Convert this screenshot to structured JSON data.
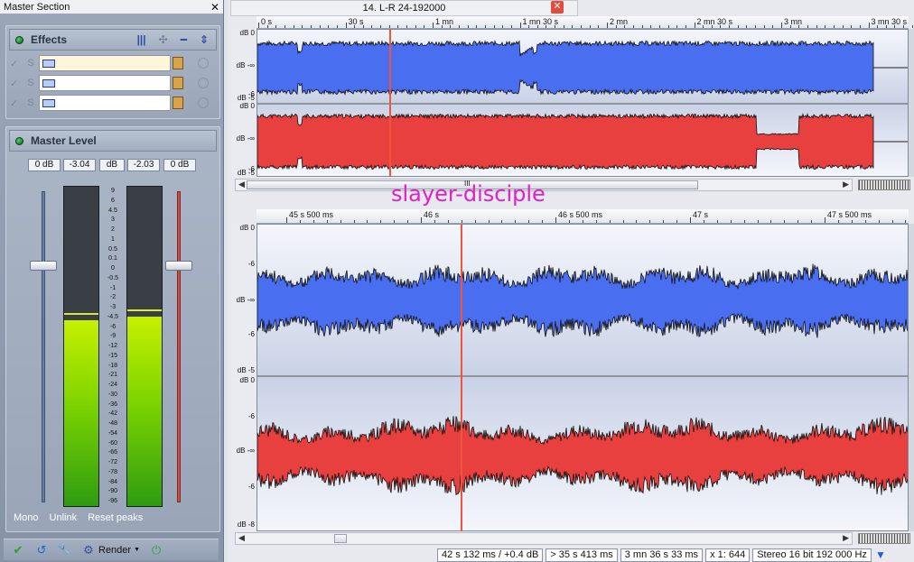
{
  "master": {
    "title": "Master Section",
    "close_label": "✕",
    "effects": {
      "title": "Effects",
      "slots": [
        {
          "check": "✓",
          "solo": "S"
        },
        {
          "check": "✓",
          "solo": "S"
        },
        {
          "check": "✓",
          "solo": "S"
        }
      ]
    },
    "level": {
      "title": "Master Level",
      "values": [
        "0 dB",
        "-3.04",
        "dB",
        "-2.03",
        "0 dB"
      ],
      "left_meter_fraction": 0.58,
      "right_meter_fraction": 0.59,
      "scale": [
        "9",
        "6",
        "4.5",
        "3",
        "2",
        "1",
        "0.5",
        "0.1",
        "0",
        "-0.5",
        "-1",
        "-2",
        "-3",
        "-4.5",
        "-6",
        "-9",
        "-12",
        "-15",
        "-18",
        "-21",
        "-24",
        "-30",
        "-36",
        "-42",
        "-48",
        "-54",
        "-60",
        "-66",
        "-72",
        "-78",
        "-84",
        "-90",
        "-96"
      ],
      "links": [
        "Mono",
        "Unlink",
        "Reset peaks"
      ]
    },
    "toolbar": {
      "render_label": "Render"
    }
  },
  "editor": {
    "tab_title": "14. L-R 24-192000",
    "tab_close": "✕",
    "overview_ruler": [
      "0 s",
      "30 s",
      "1 mn",
      "1 mn 30 s",
      "2 mn",
      "2 mn 30 s",
      "3 mn",
      "3 mn 30 s"
    ],
    "overview_gutter_top": [
      "dB 0",
      "dB -∞",
      "-6",
      "dB -5"
    ],
    "overview_gutter_bottom": [
      "dB 0",
      "dB -∞",
      "-6",
      "dB -5"
    ],
    "detail_ruler": [
      "45 s 500 ms",
      "46 s",
      "46 s 500 ms",
      "47 s",
      "47 s 500 ms"
    ],
    "detail_gutter_top": [
      "dB 0",
      "-6",
      "dB -∞",
      "-6",
      "dB -5"
    ],
    "detail_gutter_bottom": [
      "dB 0",
      "-6",
      "dB -∞",
      "-6",
      "dB -8"
    ],
    "scroll_thumb": "III",
    "watermark": "slayer-disciple",
    "colors": {
      "left_channel": "#4a6ef0",
      "right_channel": "#e8403f",
      "cursor": "#f0553c"
    }
  },
  "status": {
    "position": "42 s 132 ms / +0.4 dB",
    "selection": "> 35 s 413 ms",
    "length": "3 mn 36 s 33 ms",
    "zoom": "x 1: 644",
    "format": "Stereo 16 bit 192 000 Hz"
  }
}
